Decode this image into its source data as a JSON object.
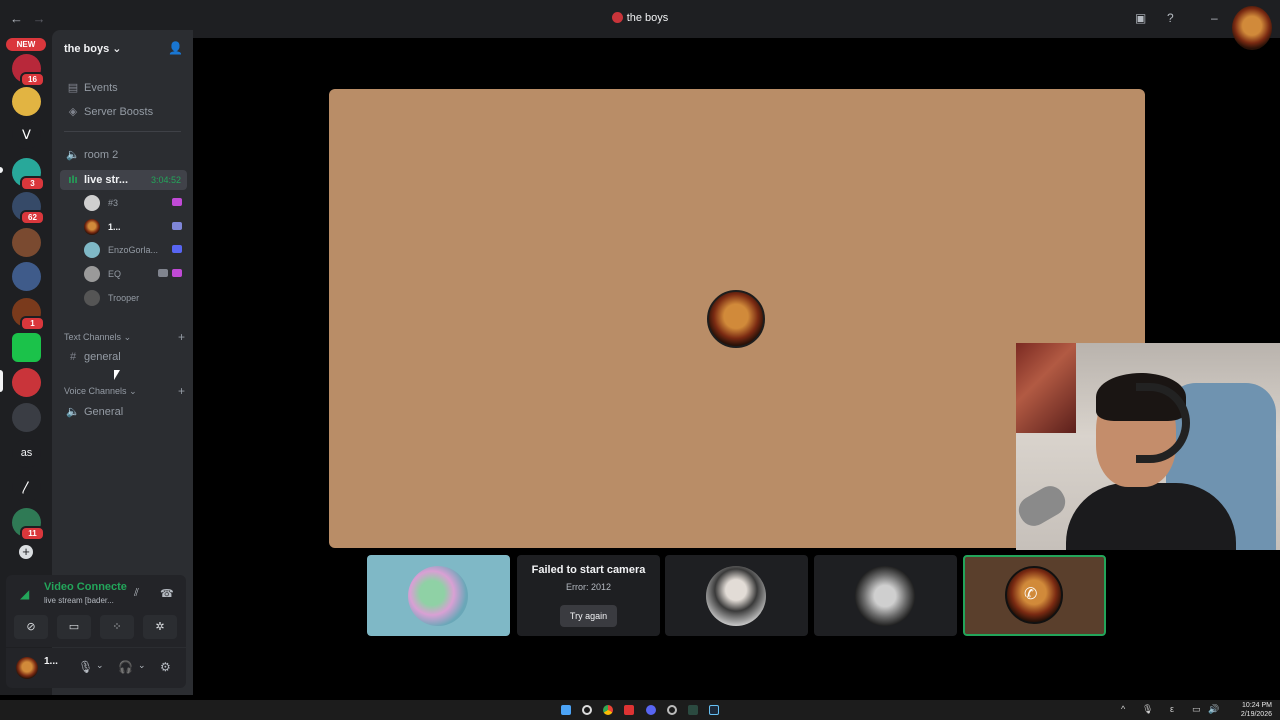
{
  "window": {
    "title": "the boys",
    "back": "←",
    "forward": "→"
  },
  "rail": {
    "new_tag": "NEW",
    "badges": [
      "16",
      "3",
      "62",
      "1",
      "11"
    ],
    "text_server": "as",
    "add_server": "+"
  },
  "sidebar": {
    "guild_name": "the boys",
    "events": "Events",
    "boosts": "Server Boosts",
    "channels": [
      {
        "name": "room 2"
      },
      {
        "name": "live str...",
        "timer": "3:04:52"
      }
    ],
    "members": [
      "#3",
      "1...",
      "EnzoGorla...",
      "EQ",
      "Trooper"
    ],
    "text_category": "Text Channels",
    "text_channel": "general",
    "voice_category": "Voice Channels",
    "voice_channel": "General"
  },
  "voice_panel": {
    "status": "Video Connecte",
    "channel": "live stream [bader..."
  },
  "user": {
    "name": "1..."
  },
  "stage": {
    "fail_title": "Failed to start camera",
    "fail_error": "Error: 2012",
    "try_again": "Try again"
  },
  "taskbar": {
    "time": "10:24 PM",
    "date": "2/19/2026",
    "lang": "ε"
  },
  "colors": {
    "accent_green": "#23a55a",
    "stage_bg": "#b98d67",
    "badge_red": "#da373c"
  }
}
